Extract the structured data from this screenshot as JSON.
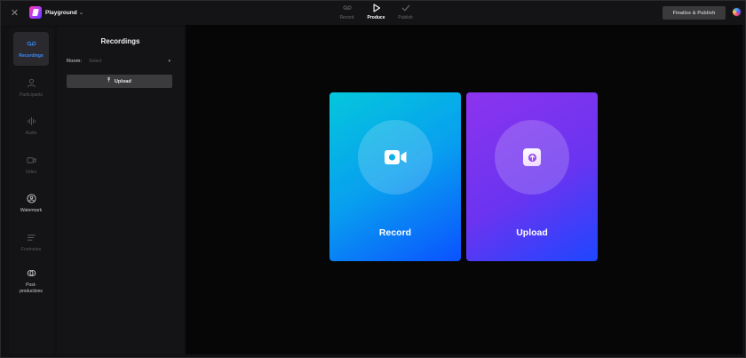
{
  "topbar": {
    "project_name": "Playground",
    "steps": [
      {
        "label": "Record",
        "state": "inactive"
      },
      {
        "label": "Produce",
        "state": "active"
      },
      {
        "label": "Publish",
        "state": "inactive"
      }
    ],
    "publish_label": "Finalize & Publish"
  },
  "rail": {
    "items": [
      {
        "label": "Recordings",
        "icon": "recording-icon"
      },
      {
        "label": "Participants",
        "icon": "person-icon"
      },
      {
        "label": "Audio",
        "icon": "audio-wave-icon"
      },
      {
        "label": "Video",
        "icon": "video-camera-icon"
      },
      {
        "label": "Watermark",
        "icon": "watermark-icon"
      },
      {
        "label": "Footnotes",
        "icon": "list-icon"
      },
      {
        "label_line1": "Post-",
        "label_line2": "productions",
        "icon": "post-production-icon"
      }
    ]
  },
  "panel": {
    "title": "Recordings",
    "room_label": "Room:",
    "room_placeholder": "Select",
    "upload_label": "Upload"
  },
  "stage": {
    "record_label": "Record",
    "upload_label": "Upload"
  },
  "colors": {
    "accent": "#3a8cff",
    "record_gradient": [
      "#04c7dc",
      "#0b52ff"
    ],
    "upload_gradient": [
      "#8c34ee",
      "#1e46ff"
    ]
  }
}
